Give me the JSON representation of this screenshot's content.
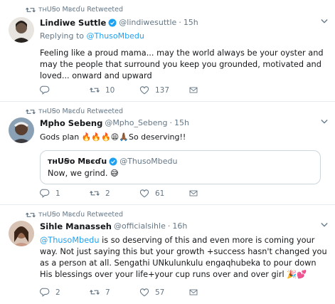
{
  "tweets": [
    {
      "retweet_label": "тнUꞨo Mвєɗu Retweeted",
      "name": "Lindiwe Suttle",
      "handle": "@lindiwesuttle",
      "dot": "·",
      "time": "15h",
      "replying_prefix": "Replying to",
      "replying_handle": "@ThusoMbedu",
      "text": "Feeling like a proud mama... may the world always be your oyster and may the people that surround you keep you grounded, motivated and loved... onward and upward",
      "replies": "",
      "retweets": "10",
      "likes": "137"
    },
    {
      "retweet_label": "тнUꞨo Mвєɗu Retweeted",
      "name": "Mpho Sebeng",
      "handle": "@Mpho_Sebeng",
      "dot": "·",
      "time": "15h",
      "text_main": "Gods plan 🔥🔥🔥😩🙏🏾So deserving!!",
      "quote_name": "тнUꞨo Mвєɗu",
      "quote_handle": "@ThusoMbedu",
      "quote_text": "Now, we grind. 😅",
      "replies": "1",
      "retweets": "2",
      "likes": "61"
    },
    {
      "retweet_label": "тнUꞨo Mвєɗu Retweeted",
      "name": "Sihle Manasseh",
      "handle": "@officialsihle",
      "dot": "·",
      "time": "16h",
      "mention": "@ThusoMbedu",
      "text_rest": " is so deserving of this and even more is coming your way. Not just saying this but your growth +success hasn't changed you as a person at all. Sengathi UNkulunkulu engaqhubeka to pour down His blessings over your life+your cup runs over and over girl 🎉💕",
      "replies": "2",
      "retweets": "7",
      "likes": "57"
    }
  ],
  "icons": {
    "retweet": "retweet-icon",
    "reply": "reply-icon",
    "like": "heart-icon",
    "dm": "envelope-icon",
    "verified": "verified-badge-icon",
    "caret": "chevron-down-icon"
  },
  "colors": {
    "link": "#1da1f2",
    "muted": "#657786",
    "verified": "#1da1f2"
  }
}
